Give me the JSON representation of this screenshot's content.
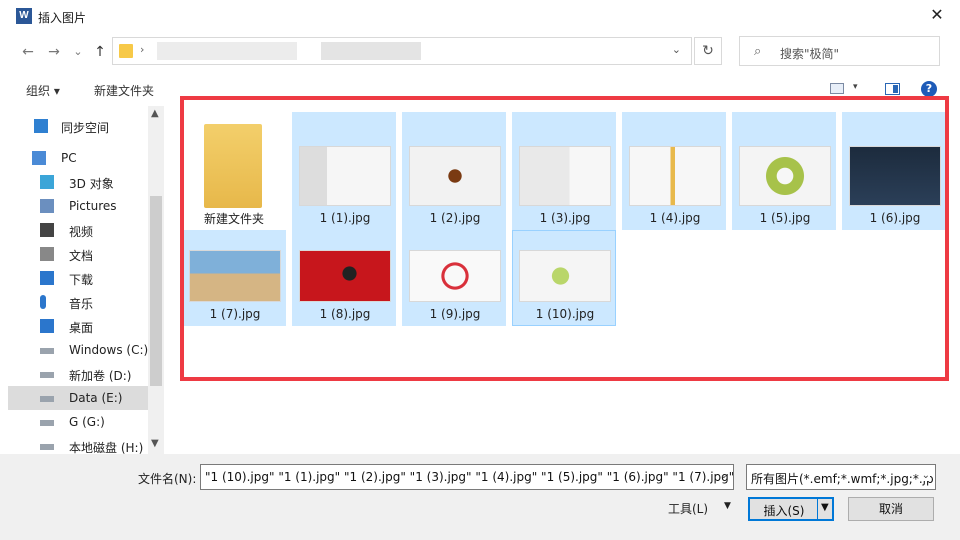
{
  "window": {
    "title": "插入图片",
    "app_icon": "W",
    "close_glyph": "✕"
  },
  "nav": {
    "back": "←",
    "forward": "→",
    "recent": "⌄",
    "up": "↑",
    "refresh": "↻",
    "address_dropdown": "⌄",
    "search_placeholder": "搜索\"极简\"",
    "search_icon": "⌕",
    "address_sep": "›"
  },
  "toolbar": {
    "organize": "组织 ▾",
    "new_folder": "新建文件夹",
    "view_dropdown": "▾",
    "help": "?"
  },
  "sidebar": {
    "items": [
      {
        "label": "同步空间",
        "icon": "sync-space-icon"
      },
      {
        "label": "PC",
        "icon": "computer-icon"
      },
      {
        "label": "3D 对象",
        "icon": "3d-objects-icon"
      },
      {
        "label": "Pictures",
        "icon": "pictures-icon"
      },
      {
        "label": "视频",
        "icon": "video-icon"
      },
      {
        "label": "文档",
        "icon": "document-icon"
      },
      {
        "label": "下载",
        "icon": "download-icon"
      },
      {
        "label": "音乐",
        "icon": "music-icon"
      },
      {
        "label": "桌面",
        "icon": "desktop-icon"
      },
      {
        "label": "Windows (C:)",
        "icon": "drive-icon"
      },
      {
        "label": "新加卷 (D:)",
        "icon": "drive-icon"
      },
      {
        "label": "Data (E:)",
        "icon": "drive-icon"
      },
      {
        "label": "G (G:)",
        "icon": "drive-icon"
      },
      {
        "label": "本地磁盘 (H:)",
        "icon": "drive-icon"
      }
    ],
    "selected": "Data (E:)"
  },
  "files": [
    {
      "name": "新建文件夹",
      "kind": "folder"
    },
    {
      "name": "1 (1).jpg",
      "kind": "image"
    },
    {
      "name": "1 (2).jpg",
      "kind": "image"
    },
    {
      "name": "1 (3).jpg",
      "kind": "image"
    },
    {
      "name": "1 (4).jpg",
      "kind": "image"
    },
    {
      "name": "1 (5).jpg",
      "kind": "image"
    },
    {
      "name": "1 (6).jpg",
      "kind": "image"
    },
    {
      "name": "1 (7).jpg",
      "kind": "image"
    },
    {
      "name": "1 (8).jpg",
      "kind": "image"
    },
    {
      "name": "1 (9).jpg",
      "kind": "image"
    },
    {
      "name": "1 (10).jpg",
      "kind": "image"
    }
  ],
  "footer": {
    "filename_label": "文件名(N):",
    "filename_value": "\"1 (10).jpg\" \"1 (1).jpg\" \"1 (2).jpg\" \"1 (3).jpg\" \"1 (4).jpg\" \"1 (5).jpg\" \"1 (6).jpg\" \"1 (7).jpg\" \"1",
    "filetype_value": "所有图片(*.emf;*.wmf;*.jpg;*.jp",
    "tools_label": "工具(L)",
    "insert_label": "插入(S)",
    "cancel_label": "取消",
    "dropdown": "⌄"
  },
  "colors": {
    "selection": "#cce8ff",
    "highlight_box": "#ee3a43",
    "accent": "#0078d7"
  }
}
